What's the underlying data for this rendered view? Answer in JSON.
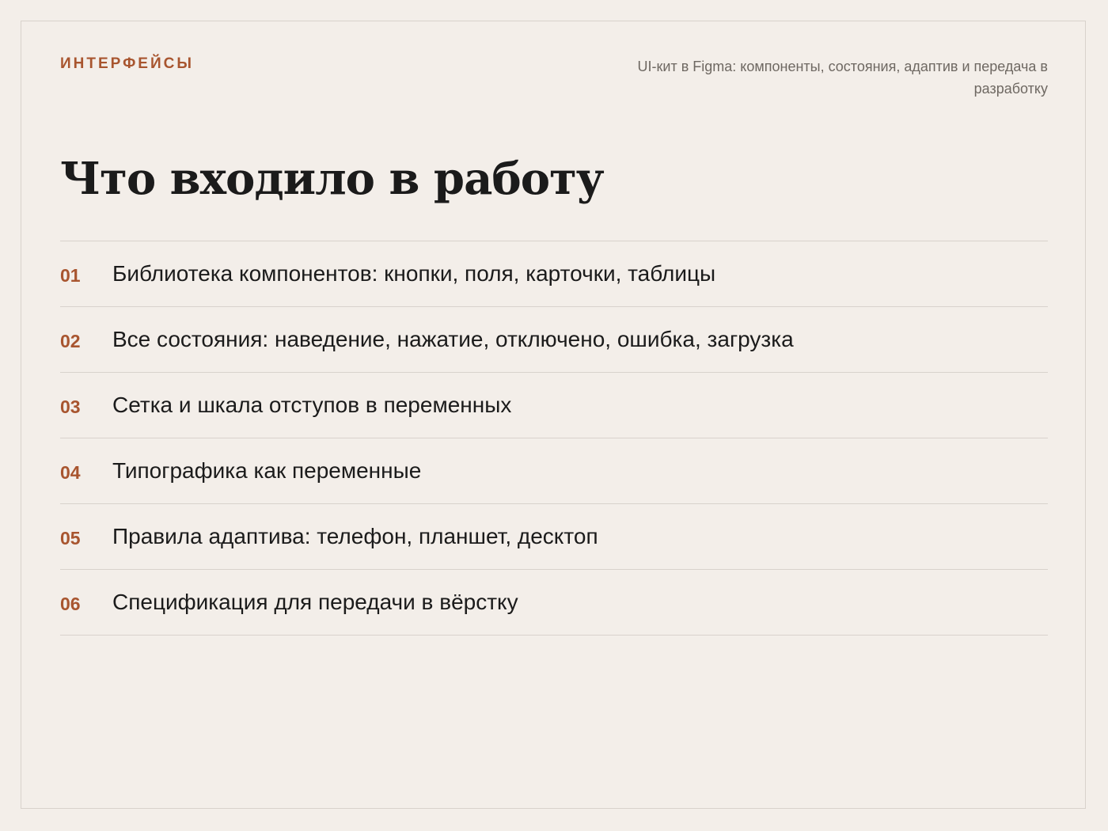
{
  "header": {
    "eyebrow": "ИНТЕРФЕЙСЫ",
    "subtitle": "UI-кит в Figma: компоненты, состояния, адаптив и передача в разработку"
  },
  "heading": "Что входило в работу",
  "items": [
    {
      "num": "01",
      "text": "Библиотека компонентов: кнопки, поля, карточки, таблицы"
    },
    {
      "num": "02",
      "text": "Все состояния: наведение, нажатие, отключено, ошибка, загрузка"
    },
    {
      "num": "03",
      "text": "Сетка и шкала отступов в переменных"
    },
    {
      "num": "04",
      "text": "Типографика как переменные"
    },
    {
      "num": "05",
      "text": "Правила адаптива: телефон, планшет, десктоп"
    },
    {
      "num": "06",
      "text": "Спецификация для передачи в вёрстку"
    }
  ],
  "colors": {
    "accent": "#a8552f",
    "background": "#f3eee9",
    "text": "#1b1b1b",
    "muted": "#6e6862",
    "divider": "#d8d2cc"
  }
}
